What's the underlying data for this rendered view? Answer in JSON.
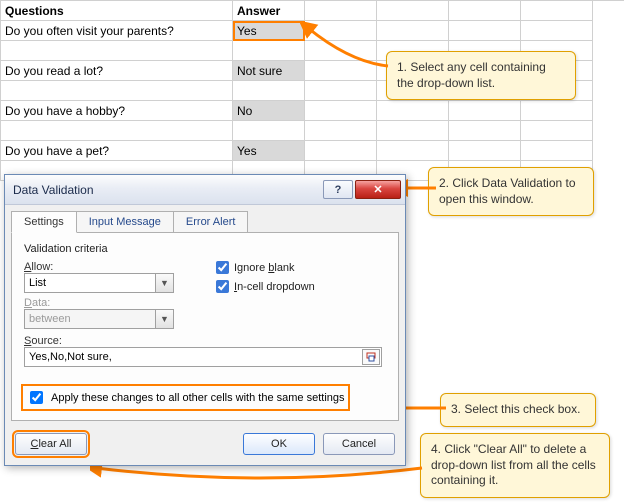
{
  "sheet": {
    "col_headers": {
      "a": "Questions",
      "b": "Answer"
    },
    "rows": [
      {
        "q": "Do you often visit your parents?",
        "a": "Yes",
        "selected": true
      },
      {
        "q": "",
        "a": ""
      },
      {
        "q": "Do you read a lot?",
        "a": "Not sure"
      },
      {
        "q": "",
        "a": ""
      },
      {
        "q": "Do you have a hobby?",
        "a": "No"
      },
      {
        "q": "",
        "a": ""
      },
      {
        "q": "Do you have a pet?",
        "a": "Yes"
      }
    ]
  },
  "callouts": {
    "c1": "1. Select any cell containing the drop-down list.",
    "c2": "2. Click Data Validation to open this window.",
    "c3": "3. Select this check box.",
    "c4": "4. Click \"Clear All\" to delete a drop-down list from all the cells containing it."
  },
  "dialog": {
    "title": "Data Validation",
    "tabs": {
      "settings": "Settings",
      "input": "Input Message",
      "error": "Error Alert"
    },
    "criteria_label": "Validation criteria",
    "allow_label": "Allow:",
    "allow_value": "List",
    "data_label": "Data:",
    "data_value": "between",
    "ignore_blank": "Ignore blank",
    "incell": "In-cell dropdown",
    "source_label": "Source:",
    "source_value": "Yes,No,Not sure,",
    "apply_label": "Apply these changes to all other cells with the same settings",
    "buttons": {
      "clear": "Clear All",
      "ok": "OK",
      "cancel": "Cancel"
    }
  },
  "colors": {
    "highlight": "#ff7f00"
  }
}
